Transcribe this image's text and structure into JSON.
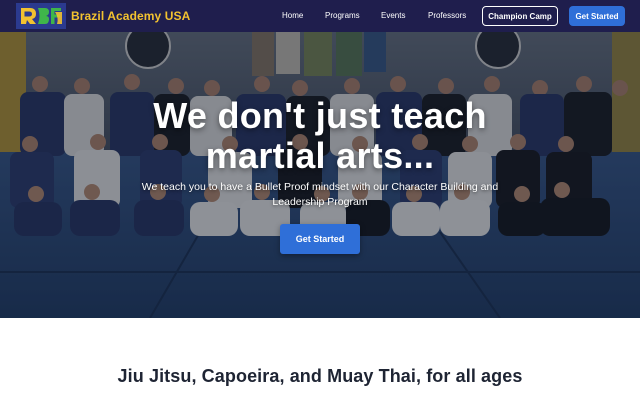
{
  "header": {
    "brand": "Brazil Academy USA",
    "nav": [
      {
        "label": "Home"
      },
      {
        "label": "Programs"
      },
      {
        "label": "Events"
      },
      {
        "label": "Professors"
      }
    ],
    "cta_outline": "Champion Camp",
    "cta_primary": "Get Started"
  },
  "hero": {
    "title_line1": "We don't just teach",
    "title_line2": "martial arts...",
    "subtitle": "We teach you to have a Bullet Proof mindset with our Character Building and Leadership Program",
    "button": "Get Started"
  },
  "section": {
    "title": "Jiu Jitsu, Capoeira, and Muay Thai, for all ages"
  },
  "colors": {
    "header_bg": "#1f1e4d",
    "brand": "#f2c230",
    "primary": "#2f6fd8",
    "section_text": "#1e2433"
  }
}
